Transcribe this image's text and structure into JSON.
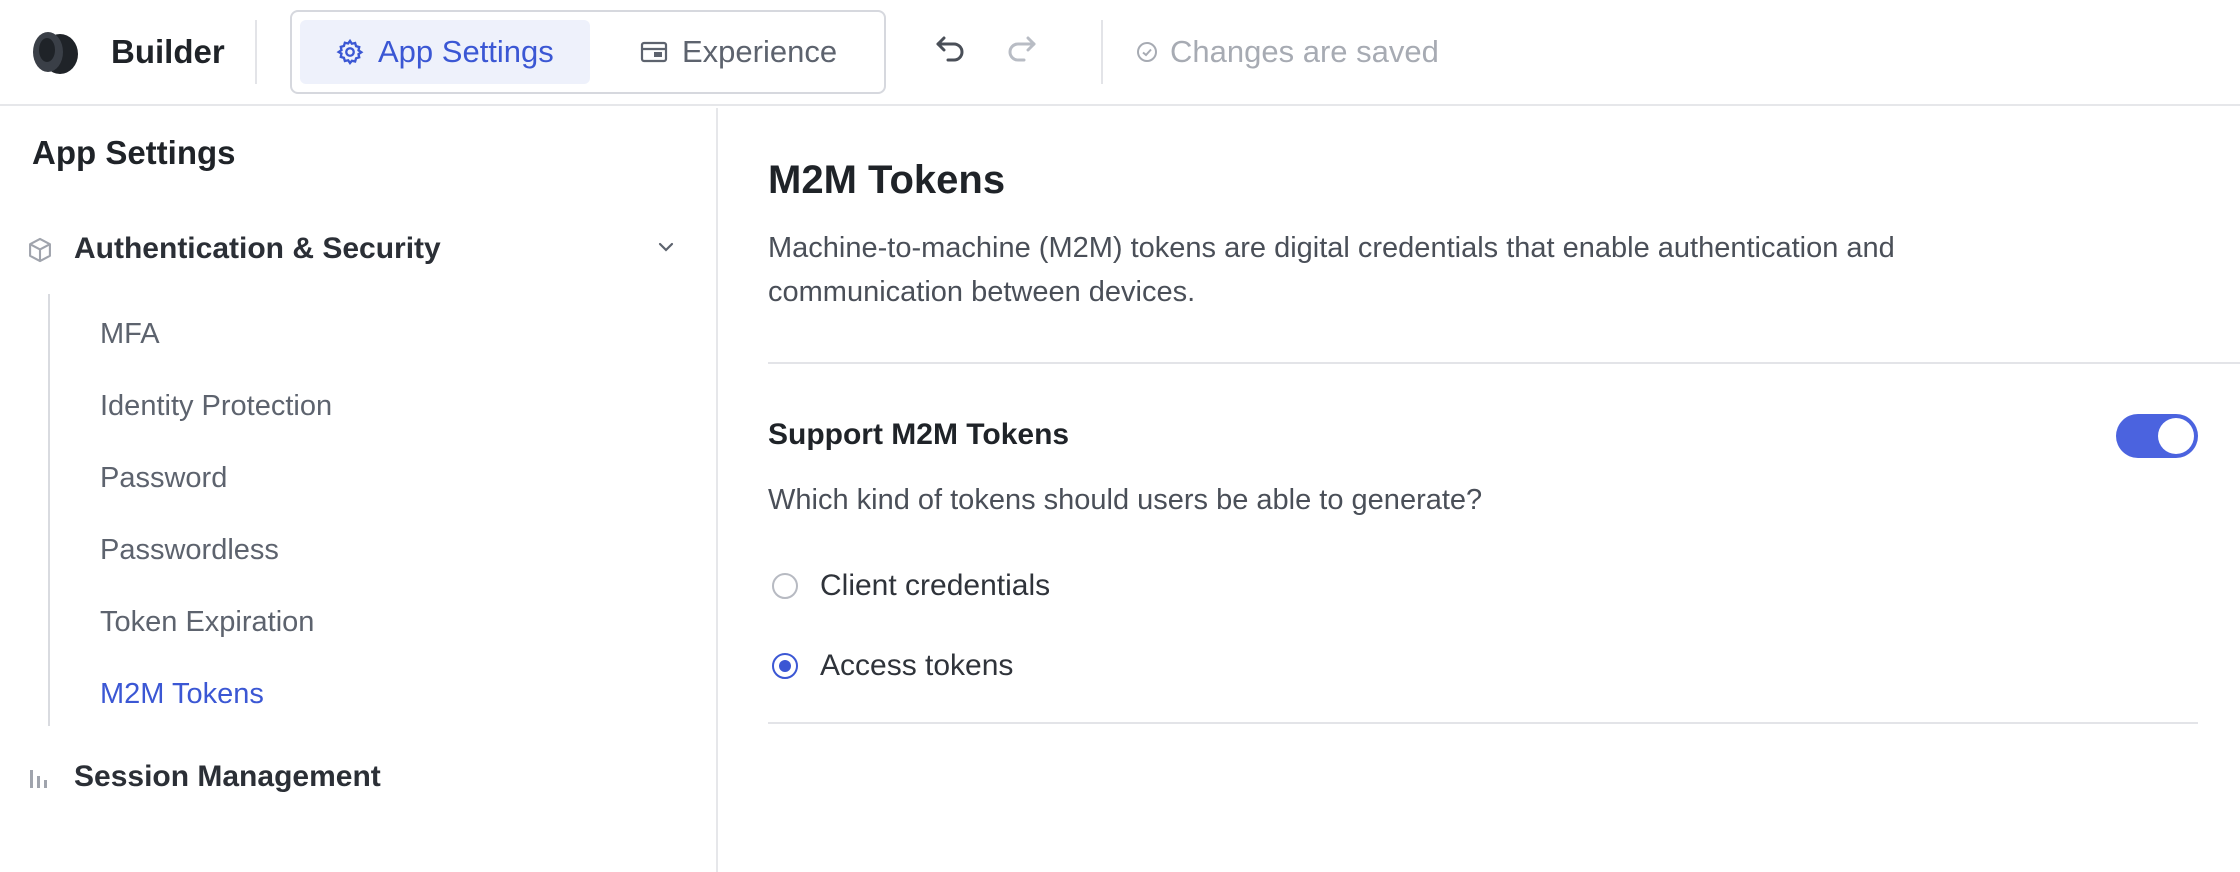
{
  "header": {
    "brand": "Builder",
    "tabs": [
      {
        "label": "App Settings",
        "icon": "gear-icon",
        "active": true
      },
      {
        "label": "Experience",
        "icon": "layout-icon",
        "active": false
      }
    ],
    "save_status": "Changes are saved"
  },
  "sidebar": {
    "title": "App Settings",
    "sections": [
      {
        "label": "Authentication & Security",
        "icon": "cube-icon",
        "expanded": true,
        "items": [
          {
            "label": "MFA"
          },
          {
            "label": "Identity Protection"
          },
          {
            "label": "Password"
          },
          {
            "label": "Passwordless"
          },
          {
            "label": "Token Expiration"
          },
          {
            "label": "M2M Tokens",
            "active": true
          }
        ]
      },
      {
        "label": "Session Management",
        "icon": "bar-chart-icon"
      }
    ]
  },
  "main": {
    "title": "M2M Tokens",
    "description": "Machine-to-machine (M2M) tokens are digital credentials that enable authentication and communication between devices.",
    "option": {
      "title": "Support M2M Tokens",
      "enabled": true,
      "question": "Which kind of tokens should users be able to generate?",
      "choices": [
        {
          "label": "Client credentials",
          "selected": false
        },
        {
          "label": "Access tokens",
          "selected": true
        }
      ]
    }
  },
  "colors": {
    "accent": "#3b57d4",
    "toggle_on": "#4b63df",
    "muted_text": "#a7abb3",
    "active_tab_bg": "#eef1fb"
  }
}
